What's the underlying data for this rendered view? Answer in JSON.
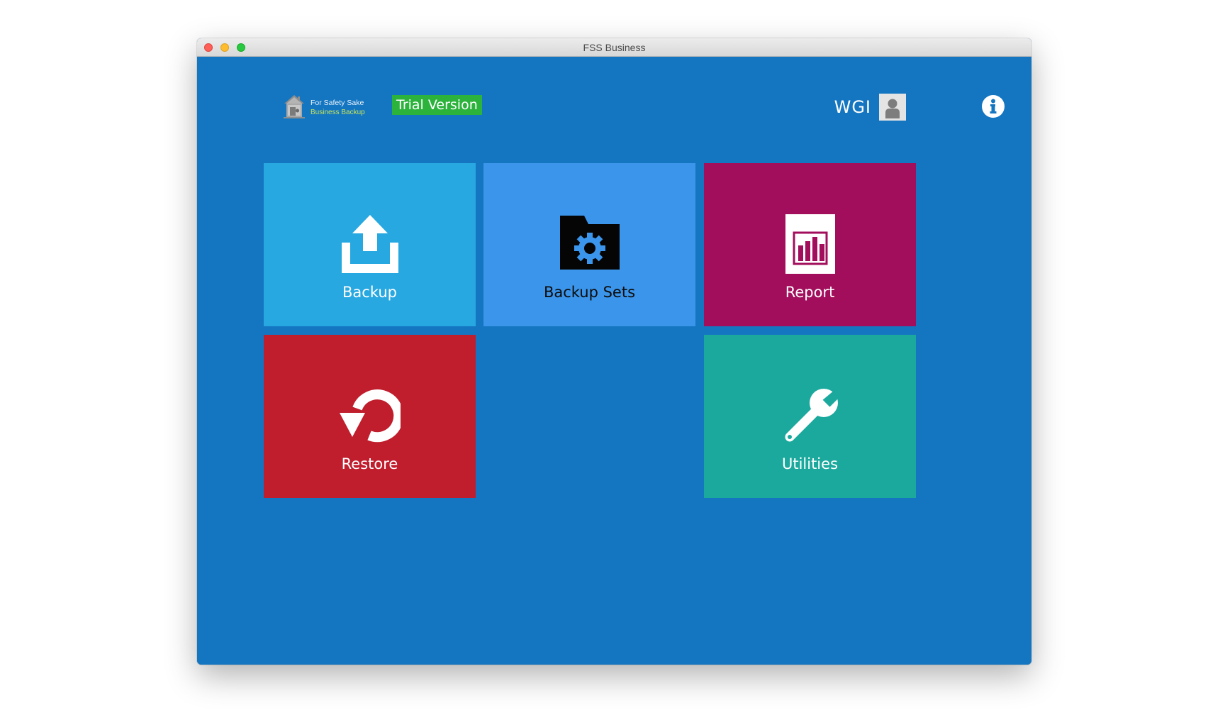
{
  "window": {
    "title": "FSS Business"
  },
  "header": {
    "logo": {
      "line1": "For Safety Sake",
      "line2": "Business Backup",
      "icon": "house-vault-icon"
    },
    "badge": "Trial Version",
    "user": {
      "name": "WGI",
      "avatar_icon": "user-silhouette-icon"
    },
    "info_icon": "info-icon"
  },
  "tiles": [
    {
      "label": "Backup",
      "icon": "upload-tray-icon",
      "color": "#27a8e1"
    },
    {
      "label": "Backup Sets",
      "icon": "folder-gear-icon",
      "color": "#3b95ea"
    },
    {
      "label": "Report",
      "icon": "bar-chart-icon",
      "color": "#a20e5c"
    },
    {
      "label": "Restore",
      "icon": "restore-arrow-icon",
      "color": "#c01d2d"
    },
    {
      "label": "Utilities",
      "icon": "wrench-icon",
      "color": "#1ca99d"
    }
  ],
  "colors": {
    "background": "#1476c1",
    "trial_badge": "#2bb33c"
  }
}
